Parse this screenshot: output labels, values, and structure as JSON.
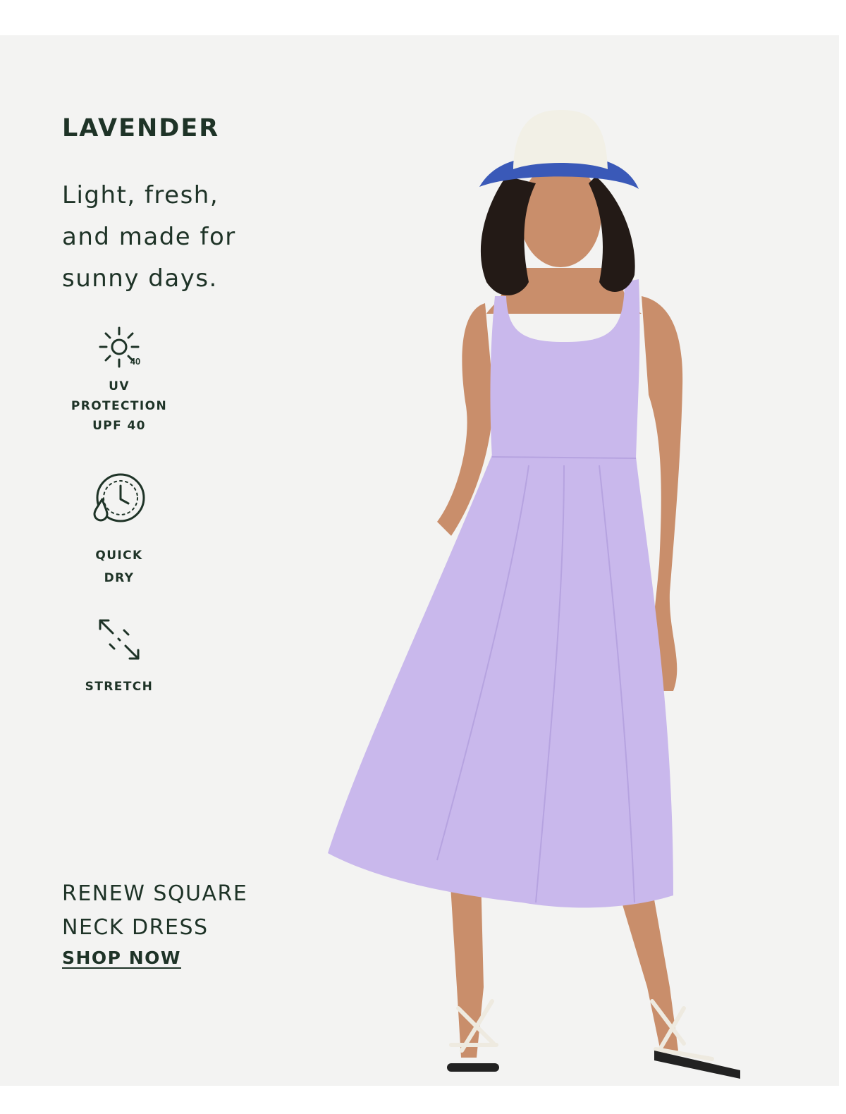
{
  "hero": {
    "color_name": "LAVENDER",
    "tagline": [
      "Light, fresh,",
      "and made for",
      "sunny days."
    ],
    "accent_color": "#1e3327",
    "background_color": "#f3f3f2",
    "dress_color": "#c9b8ec"
  },
  "features": [
    {
      "icon": "sun-uv-icon",
      "icon_text": "40",
      "label": [
        "UV",
        "PROTECTION",
        "UPF 40"
      ]
    },
    {
      "icon": "quick-dry-clock-icon",
      "label": [
        "QUICK",
        "DRY"
      ]
    },
    {
      "icon": "stretch-arrows-icon",
      "label": [
        "STRETCH"
      ]
    }
  ],
  "product": {
    "name": [
      "RENEW SQUARE",
      "NECK DRESS"
    ],
    "cta": "SHOP NOW"
  }
}
